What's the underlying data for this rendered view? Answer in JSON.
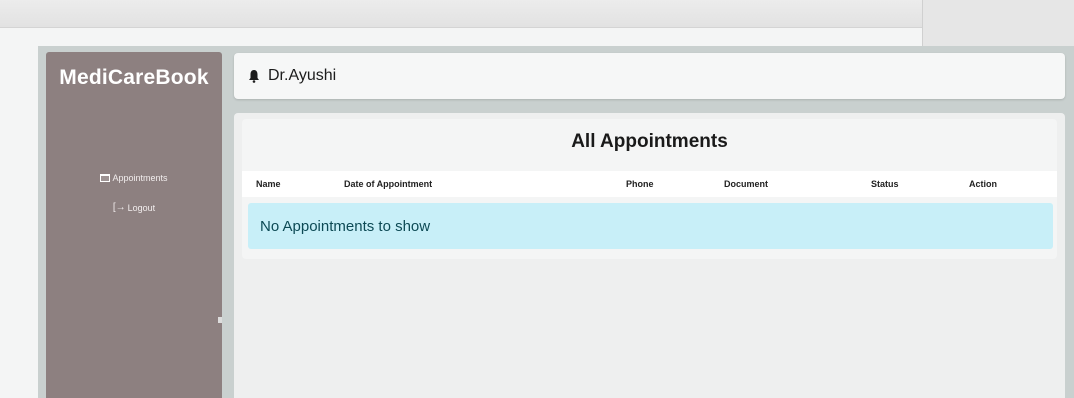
{
  "app": {
    "brand": "MediCareBook"
  },
  "sidebar": {
    "items": [
      {
        "label": "Appointments",
        "icon": "calendar-icon"
      },
      {
        "label": "Logout",
        "icon": "logout-icon"
      }
    ]
  },
  "header": {
    "user_name": "Dr.Ayushi",
    "icon": "bell-icon"
  },
  "main": {
    "title": "All Appointments",
    "columns": [
      "Name",
      "Date of Appointment",
      "Phone",
      "Document",
      "Status",
      "Action"
    ],
    "empty_message": "No Appointments to show"
  },
  "colors": {
    "sidebar_bg": "#8d8080",
    "empty_row_bg": "#c8eff8",
    "empty_row_text": "#0d4a55"
  }
}
